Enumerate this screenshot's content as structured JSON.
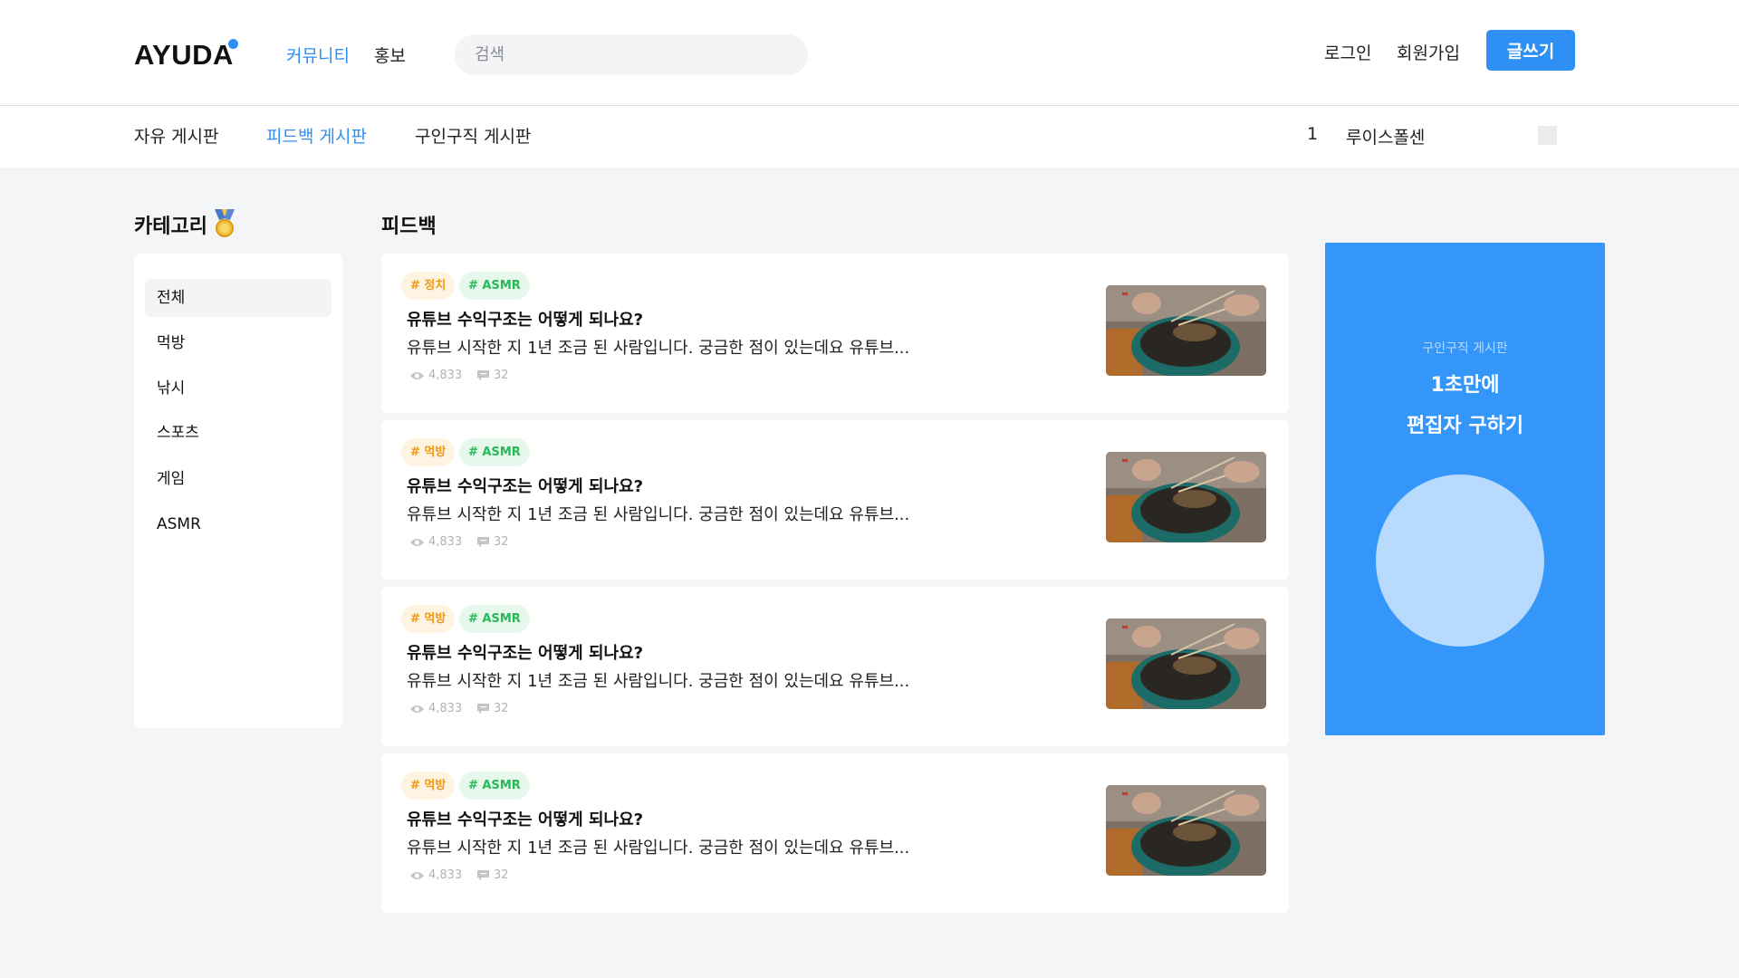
{
  "header": {
    "logo": "AYUDA",
    "nav": [
      "커뮤니티",
      "홍보"
    ],
    "search_placeholder": "검색",
    "login": "로그인",
    "signup": "회원가입",
    "write": "글쓰기"
  },
  "subnav": {
    "boards": [
      "자유 게시판",
      "피드백 게시판",
      "구인구직 게시판"
    ],
    "count": "1",
    "user": "루이스폴센"
  },
  "category": {
    "title": "카테고리",
    "items": [
      "전체",
      "먹방",
      "낚시",
      "스포츠",
      "게임",
      "ASMR"
    ]
  },
  "feed": {
    "title": "피드백",
    "posts": [
      {
        "tag1": "# 정치",
        "tag2": "# ASMR",
        "title": "유튜브 수익구조는 어떻게 되나요?",
        "body": "유튜브 시작한 지 1년 조금 된 사람입니다. 궁금한 점이 있는데요 유튜브...",
        "views": "4,833",
        "comments": "32"
      },
      {
        "tag1": "# 먹방",
        "tag2": "# ASMR",
        "title": "유튜브 수익구조는 어떻게 되나요?",
        "body": "유튜브 시작한 지 1년 조금 된 사람입니다. 궁금한 점이 있는데요 유튜브...",
        "views": "4,833",
        "comments": "32"
      },
      {
        "tag1": "# 먹방",
        "tag2": "# ASMR",
        "title": "유튜브 수익구조는 어떻게 되나요?",
        "body": "유튜브 시작한 지 1년 조금 된 사람입니다. 궁금한 점이 있는데요 유튜브...",
        "views": "4,833",
        "comments": "32"
      },
      {
        "tag1": "# 먹방",
        "tag2": "# ASMR",
        "title": "유튜브 수익구조는 어떻게 되나요?",
        "body": "유튜브 시작한 지 1년 조금 된 사람입니다. 궁금한 점이 있는데요 유튜브...",
        "views": "4,833",
        "comments": "32"
      }
    ]
  },
  "ad": {
    "small": "구인구직 게시판",
    "line1": "1초만에",
    "line2": "편집자 구하기"
  },
  "colors": {
    "accent": "#2e8ff5",
    "ad_bg": "#3596fa",
    "tag_orange": "#ef9a16",
    "tag_green": "#27b85a"
  },
  "icons": [
    "eye-icon",
    "comment-icon",
    "medal-icon"
  ]
}
